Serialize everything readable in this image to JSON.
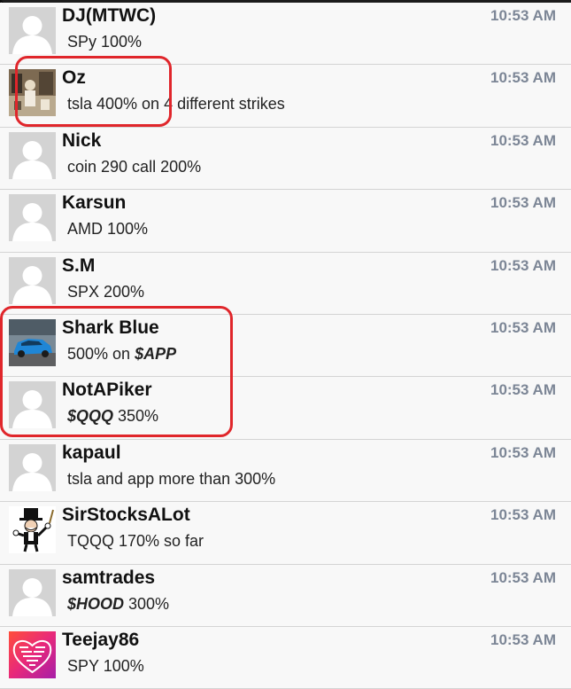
{
  "messages": [
    {
      "user": "DJ(MTWC)",
      "time": "10:53 AM",
      "text": "SPy 100%",
      "avatar": "default-avatar"
    },
    {
      "user": "Oz",
      "time": "10:53 AM",
      "text": "tsla 400% on 4 different strikes",
      "avatar": "photo-avatar"
    },
    {
      "user": "Nick",
      "time": "10:53 AM",
      "text": "coin 290 call 200%",
      "avatar": "default-avatar"
    },
    {
      "user": "Karsun",
      "time": "10:53 AM",
      "text": "AMD 100%",
      "avatar": "default-avatar"
    },
    {
      "user": "S.M",
      "time": "10:53 AM",
      "text": "SPX 200%",
      "avatar": "default-avatar"
    },
    {
      "user": "Shark Blue",
      "time": "10:53 AM",
      "text_pre": "500% on ",
      "ticker": "$APP",
      "text_post": "",
      "avatar": "blue-car-avatar"
    },
    {
      "user": "NotAPiker",
      "time": "10:53 AM",
      "text_pre": "",
      "ticker": "$QQQ",
      "text_post": " 350%",
      "avatar": "default-avatar"
    },
    {
      "user": "kapaul",
      "time": "10:53 AM",
      "text": "tsla and app more than 300%",
      "avatar": "default-avatar"
    },
    {
      "user": "SirStocksALot",
      "time": "10:53 AM",
      "text": "TQQQ  170% so far",
      "avatar": "monopoly-man-avatar"
    },
    {
      "user": "samtrades",
      "time": "10:53 AM",
      "text_pre": "",
      "ticker": "$HOOD",
      "text_post": " 300%",
      "avatar": "default-avatar"
    },
    {
      "user": "Teejay86",
      "time": "10:53 AM",
      "text": "SPY 100%",
      "avatar": "heart-art-avatar"
    }
  ],
  "colors": {
    "highlight": "#e0262b",
    "timestamp": "#7c8696",
    "row_background": "#f8f8f8"
  }
}
